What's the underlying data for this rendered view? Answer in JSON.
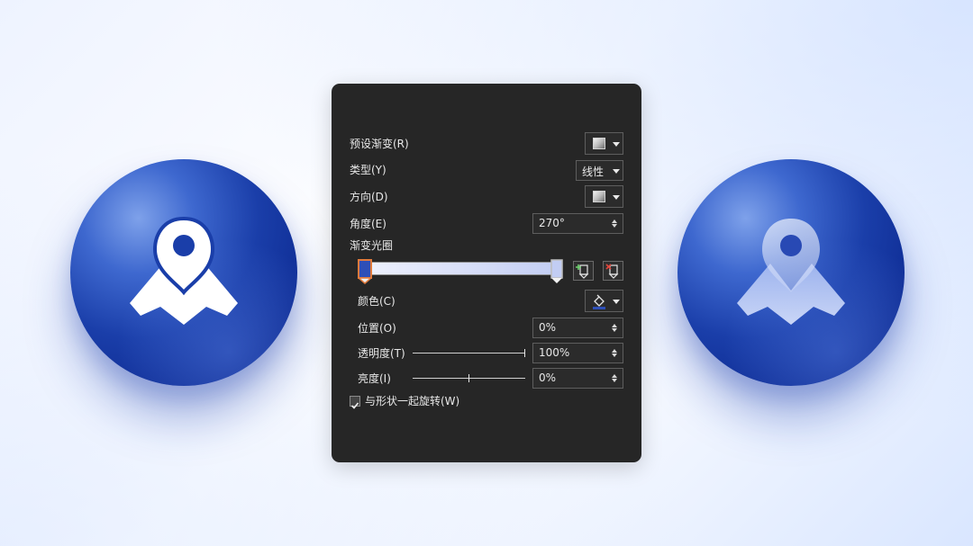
{
  "panel": {
    "preset_label": "预设渐变(R)",
    "type_label": "类型(Y)",
    "type_value": "线性",
    "direction_label": "方向(D)",
    "angle_label": "角度(E)",
    "angle_value": "270°",
    "stops_label": "渐变光圈",
    "color_label": "颜色(C)",
    "position_label": "位置(O)",
    "position_value": "0%",
    "transparency_label": "透明度(T)",
    "transparency_value": "100%",
    "transparency_level": 1.0,
    "brightness_label": "亮度(I)",
    "brightness_value": "0%",
    "brightness_level": 0.5,
    "rotate_label": "与形状一起旋转(W)",
    "rotate_checked": true
  },
  "icons": {
    "preset_dropdown": "gradient-swatch-icon",
    "direction_dropdown": "gradient-swatch-icon",
    "color_dropdown": "paint-bucket-icon",
    "add_stop": "add-gradient-stop-icon",
    "remove_stop": "remove-gradient-stop-icon",
    "left_sphere": "map-pin-icon",
    "right_sphere": "map-pin-icon"
  },
  "colors": {
    "panel_bg": "#262626",
    "sphere_blue": "#1a3ea9",
    "stop_left": "#2e4fb8",
    "stop_right": "#c2cdf3"
  }
}
